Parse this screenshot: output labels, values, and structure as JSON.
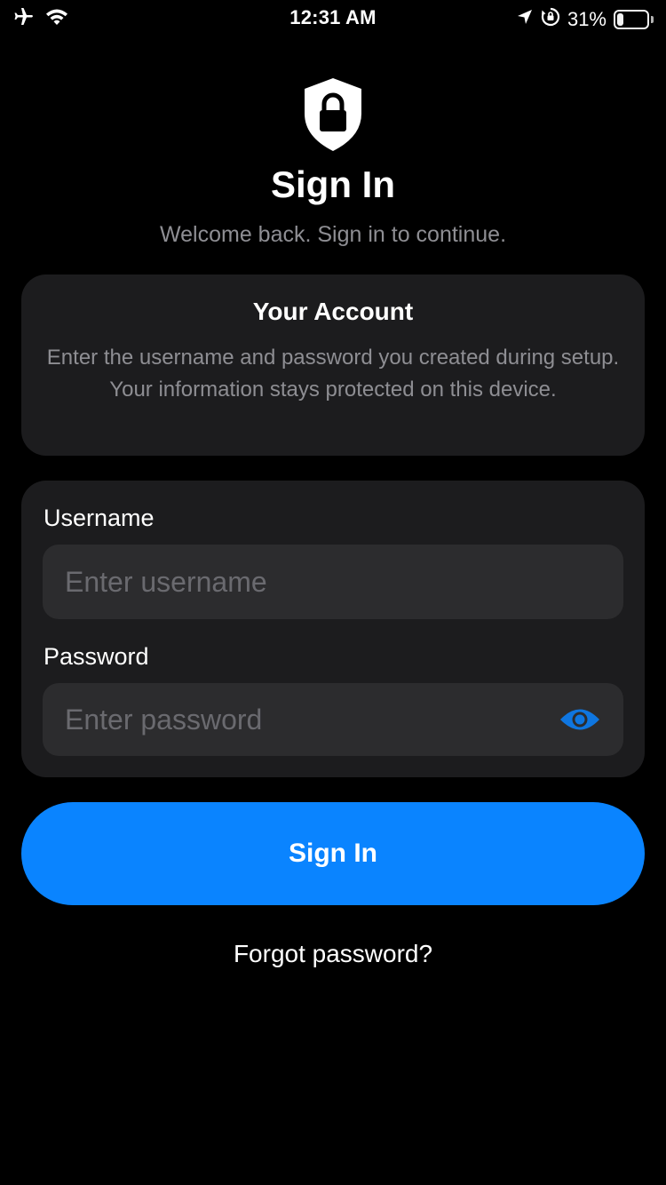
{
  "status_bar": {
    "time": "12:31 AM",
    "battery_percent_text": "31%",
    "battery_level": 0.31,
    "icons": [
      "airplane-mode-icon",
      "wifi-icon",
      "location-arrow-icon",
      "orientation-lock-icon",
      "battery-icon"
    ]
  },
  "header": {
    "icon": "shield-lock-icon",
    "title": "Sign In",
    "subtitle": "Welcome back. Sign in to continue."
  },
  "info_card": {
    "title": "Your Account",
    "body": "Enter the username and password you created during setup. Your information stays protected on this device."
  },
  "form": {
    "username": {
      "label": "Username",
      "value": "",
      "placeholder": "Enter username"
    },
    "password": {
      "label": "Password",
      "value": "",
      "placeholder": "Enter password",
      "toggle_icon": "eye-icon"
    }
  },
  "actions": {
    "sign_in_label": "Sign In",
    "forgot_label": "Forgot password?"
  },
  "colors": {
    "background": "#000000",
    "card": "#1c1c1e",
    "field": "#2c2c2e",
    "accent": "#0a84ff",
    "secondary_text": "#8e8e93"
  }
}
